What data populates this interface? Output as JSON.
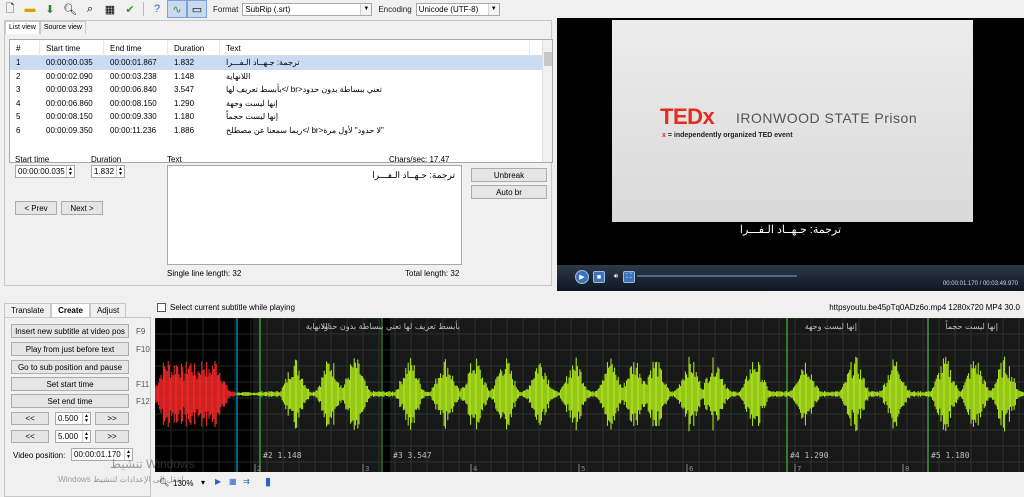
{
  "toolbar": {
    "format_label": "Format",
    "format_value": "SubRip (.srt)",
    "encoding_label": "Encoding",
    "encoding_value": "Unicode (UTF-8)"
  },
  "list": {
    "tabs": [
      "List view",
      "Source view"
    ],
    "columns": [
      "#",
      "Start time",
      "End time",
      "Duration",
      "Text"
    ],
    "rows": [
      {
        "n": "1",
        "start": "00:00:00.035",
        "end": "00:00:01.867",
        "dur": "1.832",
        "text": "ترجمة: جـهــاد الـفـــرا"
      },
      {
        "n": "2",
        "start": "00:00:02.090",
        "end": "00:00:03.238",
        "dur": "1.148",
        "text": "اللانهاية"
      },
      {
        "n": "3",
        "start": "00:00:03.293",
        "end": "00:00:06.840",
        "dur": "3.547",
        "text": "تعني ببساطة بدون حدود<br />بأبسط تعريف لها"
      },
      {
        "n": "4",
        "start": "00:00:06.860",
        "end": "00:00:08.150",
        "dur": "1.290",
        "text": "إنها ليست وجهة"
      },
      {
        "n": "5",
        "start": "00:00:08.150",
        "end": "00:00:09.330",
        "dur": "1.180",
        "text": "إنها ليست حجماً"
      },
      {
        "n": "6",
        "start": "00:00:09.350",
        "end": "00:00:11.236",
        "dur": "1.886",
        "text": "\"لا حدود\" لأول مرة<br />ربما سمعنا عن مصطلح"
      }
    ]
  },
  "editor": {
    "start_label": "Start time",
    "start_value": "00:00:00.035",
    "duration_label": "Duration",
    "duration_value": "1.832",
    "prev_label": "< Prev",
    "next_label": "Next >",
    "text_label": "Text",
    "chars_sec": "Chars/sec: 17.47",
    "text_value": "ترجمة: جـهــاد الـفـــرا",
    "unbreak_label": "Unbreak",
    "autobr_label": "Auto br",
    "single_line": "Single line length: 32",
    "total_length": "Total length: 32"
  },
  "video": {
    "ted_logo": "TEDx",
    "ted_name": "IRONWOOD STATE Prison",
    "ted_tagline_x": "x",
    "ted_tagline": "= independently organized TED event",
    "subtitle": "ترجمة: جـهــاد الـفـــرا",
    "time": "00:00:01.170 / 00:03:49.970"
  },
  "bottom": {
    "tabs": [
      "Translate",
      "Create",
      "Adjust"
    ],
    "select_current": "Select current subtitle while playing",
    "file_info": "httpsyoutu.be45pTq0ADz6o.mp4 1280x720 MP4 30.0",
    "buttons": {
      "insert": "Insert new subtitle at video pos",
      "play_before": "Play from just before text",
      "goto_pos": "Go to sub position and pause",
      "set_start": "Set start time",
      "set_end": "Set end time"
    },
    "fkeys": [
      "F9",
      "F10",
      "",
      "F11",
      "F12"
    ],
    "step_back": "<<",
    "step_fwd": ">>",
    "step1": "0.500",
    "step2": "5.000",
    "video_pos_label": "Video position:",
    "video_pos_value": "00:00:01.170",
    "zoom": "130%"
  },
  "waveform": {
    "segments": [
      {
        "label": "اللانهاية",
        "num": "#2",
        "dur": "1.148"
      },
      {
        "label": "بأبسط تعريف لها تعني ببساطة بدون حدود",
        "num": "#3",
        "dur": "3.547"
      },
      {
        "label": "إنها ليست وجهة",
        "num": "#4",
        "dur": "1.290"
      },
      {
        "label": "إنها ليست حجماً",
        "num": "#5",
        "dur": "1.180"
      }
    ],
    "ticks": [
      "2",
      "3",
      "4",
      "5",
      "6",
      "7",
      "8"
    ],
    "colors": {
      "selected": "#ff2a2a",
      "wave": "#b5f21a",
      "bg": "#000000"
    }
  },
  "watermark": {
    "line1": "تنشيط Windows",
    "line2": "انتقل إلى الإعدادات لتنشيط Windows."
  }
}
